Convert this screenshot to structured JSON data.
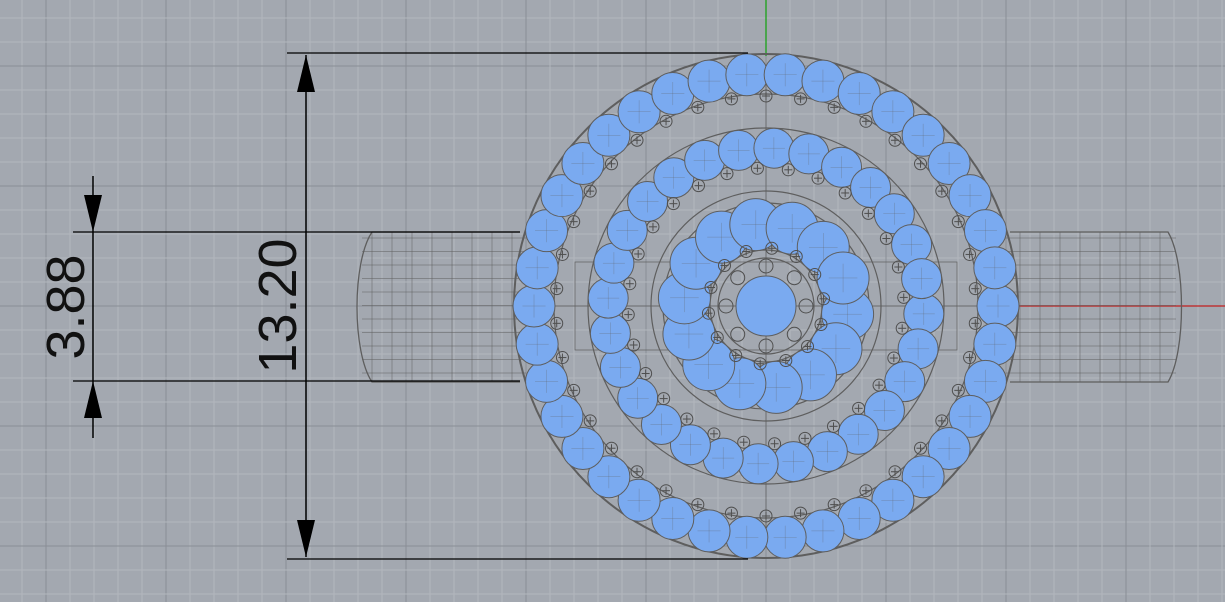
{
  "viewport": {
    "background_color": "#a3a8b0",
    "grid_minor_color": "#b3b7be",
    "grid_major_color": "#898e96",
    "x_axis_color": "#c21f1f",
    "y_axis_color": "#23a323",
    "wire_color": "#5e5e5e",
    "gem_color": "#7aaaf0"
  },
  "dimensions": {
    "height_label": "13.20",
    "band_width_label": "3.88"
  }
}
